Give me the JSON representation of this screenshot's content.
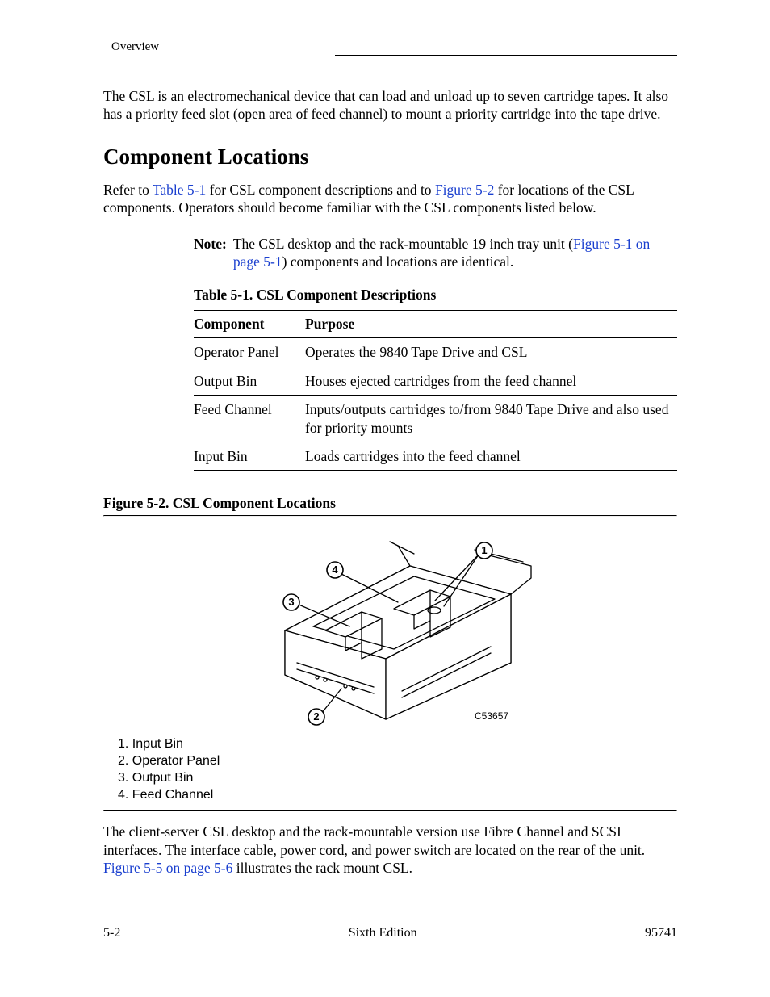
{
  "running_head": "Overview",
  "intro": "The CSL is an electromechanical device that can load and unload up to seven cartridge tapes. It also has a priority feed slot (open area of feed channel) to mount a priority cartridge into the tape drive.",
  "section_title": "Component Locations",
  "para1_a": "Refer to ",
  "link_table": "Table 5-1",
  "para1_b": " for CSL component descriptions and to ",
  "link_fig2": "Figure 5-2",
  "para1_c": " for locations of the CSL components. Operators should become familiar with the CSL components listed below.",
  "note_label": "Note:",
  "note_a": "The CSL desktop and the rack-mountable 19 inch tray unit (",
  "link_fig1": "Figure 5-1 on page 5-1",
  "note_b": ") components and locations are identical.",
  "table_caption": "Table 5-1. CSL Component Descriptions",
  "table": {
    "headers": [
      "Component",
      "Purpose"
    ],
    "rows": [
      [
        "Operator Panel",
        "Operates the 9840 Tape Drive and CSL"
      ],
      [
        "Output Bin",
        "Houses ejected cartridges from the feed channel"
      ],
      [
        "Feed Channel",
        "Inputs/outputs cartridges to/from 9840 Tape Drive and also used for priority mounts"
      ],
      [
        "Input Bin",
        "Loads cartridges into the feed channel"
      ]
    ]
  },
  "figure_caption": "Figure 5-2. CSL Component Locations",
  "artwork_number": "C53657",
  "callouts": [
    "1.   Input Bin",
    "2.   Operator Panel",
    "3.   Output Bin",
    "4.   Feed Channel"
  ],
  "closing_a": "The client-server CSL desktop and the rack-mountable version use Fibre Channel and SCSI interfaces. The interface cable, power cord, and power switch are located on the rear of the unit. ",
  "link_fig5": "Figure 5-5 on page 5-6",
  "closing_b": " illustrates the rack mount CSL.",
  "footer": {
    "left": "5-2",
    "center": "Sixth Edition",
    "right": "95741"
  },
  "callout_numbers": {
    "n1": "1",
    "n2": "2",
    "n3": "3",
    "n4": "4"
  }
}
